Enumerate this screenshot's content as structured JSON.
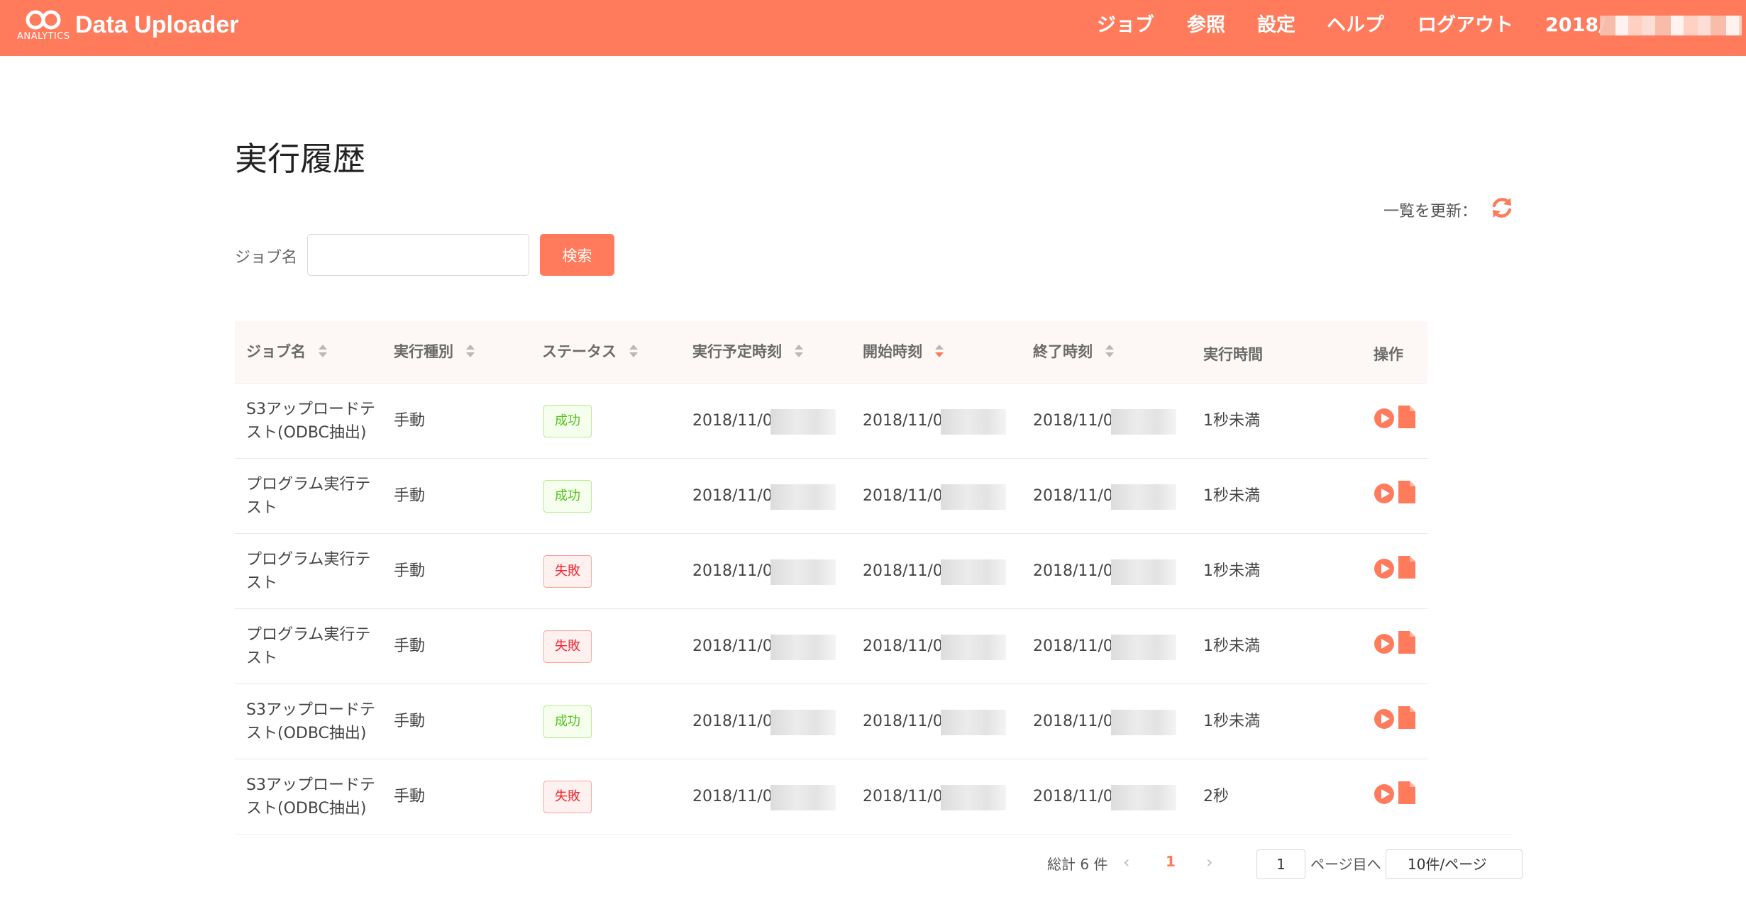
{
  "header": {
    "logo_sub": "ANALYTICS",
    "brand": "Data Uploader",
    "nav": [
      "ジョブ",
      "参照",
      "設定",
      "ヘルプ",
      "ログアウト"
    ],
    "date_prefix": "2018/"
  },
  "page": {
    "title": "実行履歴",
    "refresh_label": "一覧を更新："
  },
  "search": {
    "label": "ジョブ名",
    "placeholder": "",
    "button": "検索"
  },
  "table": {
    "columns": [
      "ジョブ名",
      "実行種別",
      "ステータス",
      "実行予定時刻",
      "開始時刻",
      "終了時刻",
      "実行時間",
      "操作"
    ],
    "rows": [
      {
        "job": "S3アップロードテスト(ODBC抽出)",
        "type": "手動",
        "status": "成功",
        "scheduled": "2018/11/05",
        "start": "2018/11/05",
        "end": "2018/11/05",
        "duration": "1秒未満"
      },
      {
        "job": "プログラム実行テスト",
        "type": "手動",
        "status": "成功",
        "scheduled": "2018/11/05",
        "start": "2018/11/05",
        "end": "2018/11/05",
        "duration": "1秒未満"
      },
      {
        "job": "プログラム実行テスト",
        "type": "手動",
        "status": "失敗",
        "scheduled": "2018/11/05",
        "start": "2018/11/05",
        "end": "2018/11/05",
        "duration": "1秒未満"
      },
      {
        "job": "プログラム実行テスト",
        "type": "手動",
        "status": "失敗",
        "scheduled": "2018/11/05",
        "start": "2018/11/05",
        "end": "2018/11/05",
        "duration": "1秒未満"
      },
      {
        "job": "S3アップロードテスト(ODBC抽出)",
        "type": "手動",
        "status": "成功",
        "scheduled": "2018/11/05",
        "start": "2018/11/05",
        "end": "2018/11/05",
        "duration": "1秒未満"
      },
      {
        "job": "S3アップロードテスト(ODBC抽出)",
        "type": "手動",
        "status": "失敗",
        "scheduled": "2018/11/05",
        "start": "2018/11/05",
        "end": "2018/11/05",
        "duration": "2秒"
      }
    ]
  },
  "pagination": {
    "total": "総計 6 件",
    "prev": "‹",
    "current": "1",
    "next": "›",
    "jump_value": "1",
    "jump_label": "ページ目へ",
    "page_size": "10件/ページ"
  },
  "colors": {
    "accent": "#ff7b5c",
    "success": "#52c41a",
    "failure": "#f5222d"
  },
  "icons": {
    "refresh": "refresh-icon",
    "run": "play-icon",
    "log": "document-icon",
    "sort": "sort-icon"
  }
}
